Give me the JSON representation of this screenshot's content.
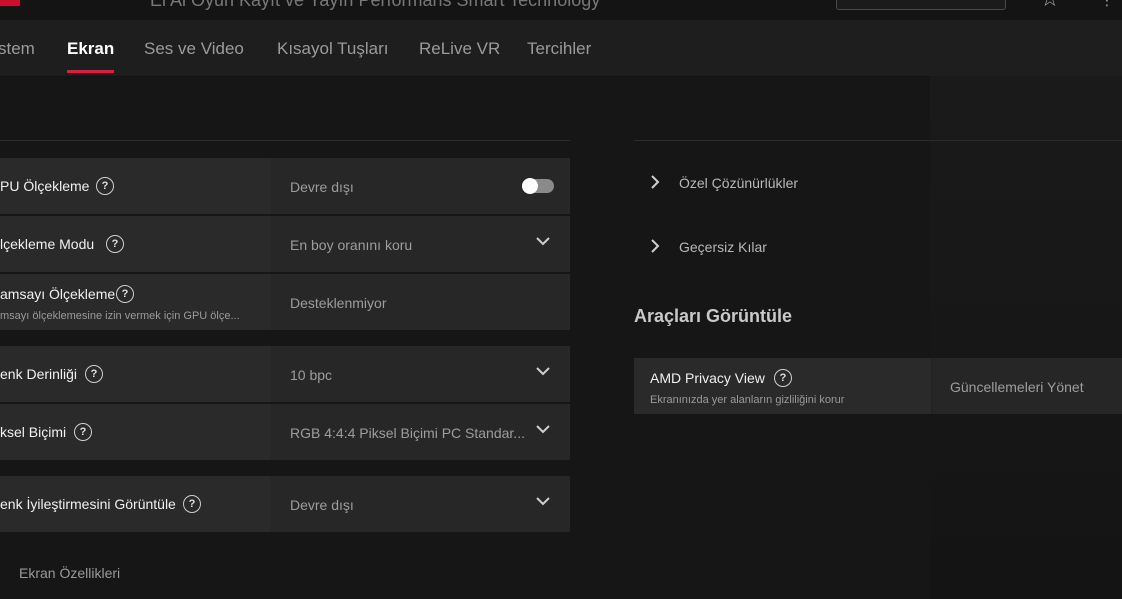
{
  "top_nav": {
    "visible_text": "Ei     Ai     Oyun     Kayıt ve Yayın     Performans     Smart Technology"
  },
  "tabs": [
    {
      "label": "stem",
      "active": false
    },
    {
      "label": "Ekran",
      "active": true
    },
    {
      "label": "Ses ve Video",
      "active": false
    },
    {
      "label": "Kısayol Tuşları",
      "active": false
    },
    {
      "label": "ReLive VR",
      "active": false
    },
    {
      "label": "Tercihler",
      "active": false
    }
  ],
  "settings": {
    "gpu_scaling": {
      "label": "PU Ölçekleme",
      "value": "Devre dışı",
      "toggle_on": false
    },
    "scaling_mode": {
      "label": "lçekleme Modu",
      "value": "En boy oranını koru"
    },
    "integer_scaling": {
      "label": "amsayı Ölçekleme",
      "sublabel": "msayı ölçeklemesine izin vermek için GPU ölçe...",
      "value": "Desteklenmiyor"
    },
    "color_depth": {
      "label": "enk Derinliği",
      "value": "10 bpc"
    },
    "pixel_format": {
      "label": "ksel Biçimi",
      "value": "RGB 4:4:4 Piksel Biçimi PC Standar..."
    },
    "color_enhancement": {
      "label": "enk İyileştirmesini Görüntüle",
      "value": "Devre dışı"
    }
  },
  "right_links": {
    "custom_resolutions": "Özel Çözünürlükler",
    "overrides": "Geçersiz Kılar"
  },
  "view_tools": {
    "heading": "Araçları Görüntüle",
    "privacy_view": {
      "title": "AMD Privacy View",
      "subtitle": "Ekranınızda yer alanların gizliliğini korur",
      "action": "Güncellemeleri Yönet"
    }
  },
  "footer": {
    "label": "Ekran Özellikleri"
  },
  "colors": {
    "accent": "#d81f3c"
  }
}
